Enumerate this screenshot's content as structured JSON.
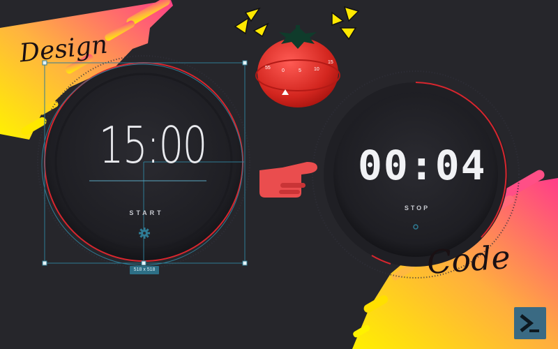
{
  "banners": {
    "design_text": "Design",
    "code_text": "Code"
  },
  "left_timer": {
    "time": "15:00",
    "action_label": "START",
    "dimension_label": "518 x 518"
  },
  "right_timer": {
    "time": "00:04",
    "action_label": "STOP"
  },
  "tomato_timer": {
    "dial_numbers": [
      "55",
      "0",
      "5",
      "10",
      "15"
    ]
  },
  "icons": [
    "tomato-timer-icon",
    "pointing-hand-icon",
    "sparkle-burst-icon",
    "gear-icon",
    "terminal-icon"
  ],
  "colors": {
    "background": "#26262b",
    "accent_red": "#d8262e",
    "gradient_pink": "#ff3d86",
    "gradient_yellow": "#ffe800",
    "guide_blue": "#2f7c95"
  }
}
